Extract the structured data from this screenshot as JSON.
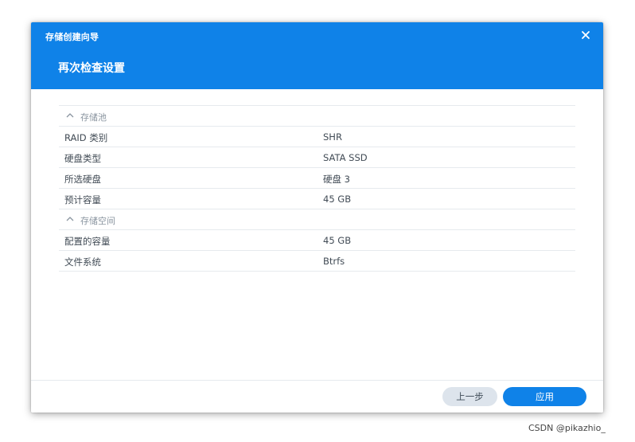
{
  "dialog": {
    "window_title": "存储创建向导",
    "step_title": "再次检查设置",
    "close_icon": "close-icon"
  },
  "sections": [
    {
      "title": "存储池",
      "rows": [
        {
          "label": "RAID 类别",
          "value": "SHR"
        },
        {
          "label": "硬盘类型",
          "value": "SATA SSD"
        },
        {
          "label": "所选硬盘",
          "value": "硬盘 3"
        },
        {
          "label": "预计容量",
          "value": "45 GB"
        }
      ]
    },
    {
      "title": "存储空间",
      "rows": [
        {
          "label": "配置的容量",
          "value": "45 GB"
        },
        {
          "label": "文件系统",
          "value": "Btrfs"
        }
      ]
    }
  ],
  "footer": {
    "back_label": "上一步",
    "apply_label": "应用"
  },
  "watermark": "CSDN @pikazhio_",
  "colors": {
    "header_bg": "#0f82e8",
    "primary_button": "#0f82e8",
    "secondary_button": "#dde4ec"
  }
}
